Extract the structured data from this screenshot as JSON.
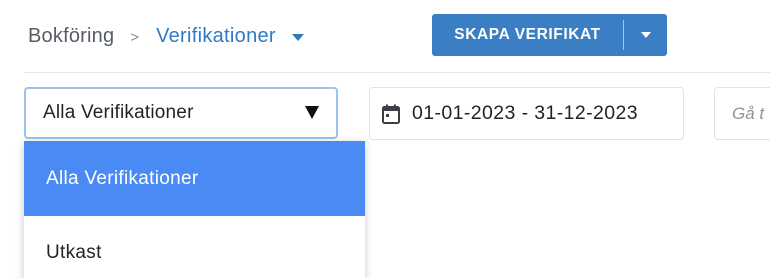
{
  "breadcrumb": {
    "root": "Bokföring",
    "separator": ">",
    "current": "Verifikationer"
  },
  "toolbar": {
    "create_label": "SKAPA VERIFIKAT",
    "toggle_icon": "caret-down-icon"
  },
  "filter": {
    "selected": "Alla Verifikationer",
    "arrow_icon": "triangle-down-icon",
    "options": [
      {
        "label": "Alla Verifikationer",
        "active": true
      },
      {
        "label": "Utkast",
        "active": false
      }
    ]
  },
  "date_range": {
    "icon": "calendar-icon",
    "value": "01-01-2023 - 31-12-2023"
  },
  "goto": {
    "placeholder": "Gå t"
  },
  "colors": {
    "accent": "#2e7bc4",
    "button": "#3a7fc3",
    "active_option": "#4a8af4",
    "focus_border": "#9cc4ea"
  }
}
